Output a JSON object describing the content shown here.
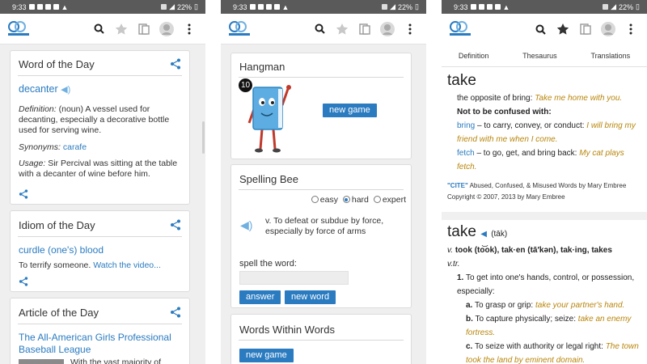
{
  "status": {
    "time": "9:33",
    "battery": "22%"
  },
  "screen1": {
    "wotd": {
      "title": "Word of the Day",
      "word": "decanter",
      "definition_label": "Definition:",
      "definition_text": "(noun) A vessel used for decanting, especially a decorative bottle used for serving wine.",
      "synonyms_label": "Synonyms:",
      "synonym": "carafe",
      "usage_label": "Usage:",
      "usage_text": "Sir Percival was sitting at the table with a decanter of wine before him."
    },
    "idiom": {
      "title": "Idiom of the Day",
      "phrase": "curdle (one's) blood",
      "meaning": "To terrify someone.",
      "video_link": "Watch the video..."
    },
    "article": {
      "title": "Article of the Day",
      "headline": "The All-American Girls Professional Baseball League",
      "snippet": "With the vast majority of"
    }
  },
  "screen2": {
    "hangman": {
      "title": "Hangman",
      "count": "10",
      "new_game": "new game"
    },
    "spelling": {
      "title": "Spelling Bee",
      "options": [
        "easy",
        "hard",
        "expert"
      ],
      "selected": "hard",
      "definition": "v. To defeat or subdue by force, especially by force of arms",
      "prompt": "spell the word:",
      "answer_btn": "answer",
      "new_word_btn": "new word"
    },
    "wiw": {
      "title": "Words Within Words",
      "new_game": "new game"
    }
  },
  "screen3": {
    "tabs": [
      "Definition",
      "Thesaurus",
      "Translations"
    ],
    "entry1": {
      "headword": "take",
      "sense": "the opposite of bring:",
      "sense_example": "Take me home with you.",
      "confusion_label": "Not to be confused with:",
      "bring_word": "bring",
      "bring_def": "– to carry, convey, or conduct:",
      "bring_example": "I will bring my friend with me when I come.",
      "fetch_word": "fetch",
      "fetch_def": "– to go, get, and bring back:",
      "fetch_example": "My cat plays fetch.",
      "cite_label": "\"CITE\"",
      "cite_text": "Abused, Confused, & Misused Words by Mary Embree Copyright © 2007, 2013 by Mary Embree"
    },
    "entry2": {
      "headword": "take",
      "pron": "(tāk)",
      "forms_pos": "v.",
      "forms_text": "took (to͝ok), tak·en (tā′kən), tak·ing, takes",
      "pos": "v.tr.",
      "def1_num": "1.",
      "def1": "To get into one's hands, control, or possession, especially:",
      "a_label": "a.",
      "a_text": "To grasp or grip:",
      "a_example": "take your partner's hand.",
      "b_label": "b.",
      "b_text": "To capture physically; seize:",
      "b_example": "take an enemy fortress.",
      "c_label": "c.",
      "c_text": "To seize with authority or legal right:",
      "c_example": "The town took the land by eminent domain."
    }
  }
}
